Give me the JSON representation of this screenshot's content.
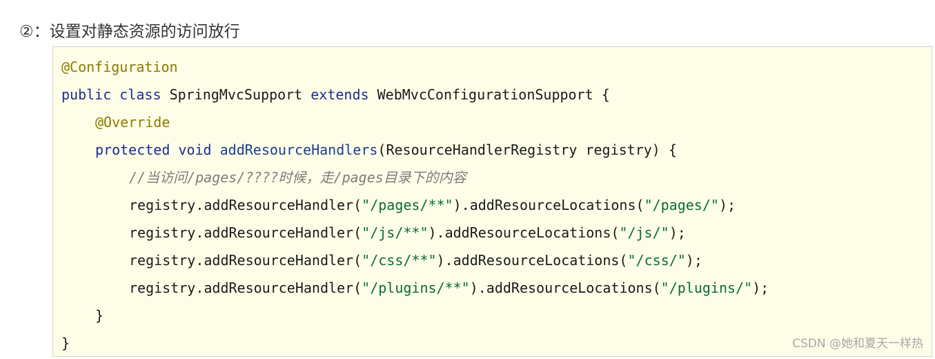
{
  "heading": "②：设置对静态资源的访问放行",
  "code": {
    "line1": {
      "annotation": "@Configuration"
    },
    "line2": {
      "kw_public": "public",
      "kw_class": "class",
      "class_name": "SpringMvcSupport",
      "kw_extends": "extends",
      "parent_class": "WebMvcConfigurationSupport",
      "brace": "{"
    },
    "line3": {
      "annotation": "@Override"
    },
    "line4": {
      "kw_protected": "protected",
      "kw_void": "void",
      "method_name": "addResourceHandlers",
      "params": "(ResourceHandlerRegistry registry) {"
    },
    "line5": {
      "comment": "//当访问/pages/????时候，走/pages目录下的内容"
    },
    "line6": {
      "prefix": "registry.addResourceHandler(",
      "handler": "\"/pages/**\"",
      "middle": ").addResourceLocations(",
      "location": "\"/pages/\"",
      "suffix": ");"
    },
    "line7": {
      "prefix": "registry.addResourceHandler(",
      "handler": "\"/js/**\"",
      "middle": ").addResourceLocations(",
      "location": "\"/js/\"",
      "suffix": ");"
    },
    "line8": {
      "prefix": "registry.addResourceHandler(",
      "handler": "\"/css/**\"",
      "middle": ").addResourceLocations(",
      "location": "\"/css/\"",
      "suffix": ");"
    },
    "line9": {
      "prefix": "registry.addResourceHandler(",
      "handler": "\"/plugins/**\"",
      "middle": ").addResourceLocations(",
      "location": "\"/plugins/\"",
      "suffix": ");"
    },
    "line10": {
      "brace": "}"
    },
    "line11": {
      "brace": "}"
    }
  },
  "watermark": "CSDN @她和夏天一样热",
  "colors": {
    "keyword": "#1c2b8f",
    "annotation": "#8a7a00",
    "string": "#0b6b3a",
    "comment": "#7d7d7d",
    "code_background": "#fdfde8"
  }
}
